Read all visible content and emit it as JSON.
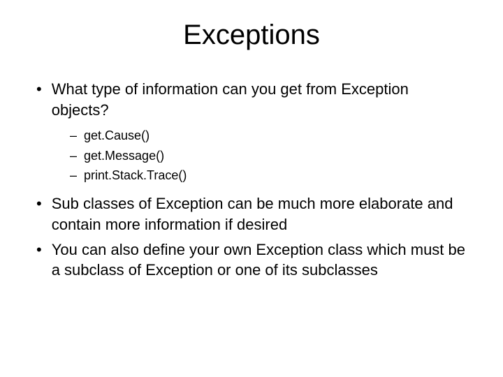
{
  "title": "Exceptions",
  "bullets": [
    {
      "text": "What type of information can you get from Exception objects?",
      "sub": [
        "get.Cause()",
        "get.Message()",
        "print.Stack.Trace()"
      ]
    },
    {
      "text": "Sub classes of Exception can be much more elaborate and contain more information if desired",
      "sub": []
    },
    {
      "text": "You can also define your own Exception class which must be a subclass of Exception or one of its subclasses",
      "sub": []
    }
  ]
}
